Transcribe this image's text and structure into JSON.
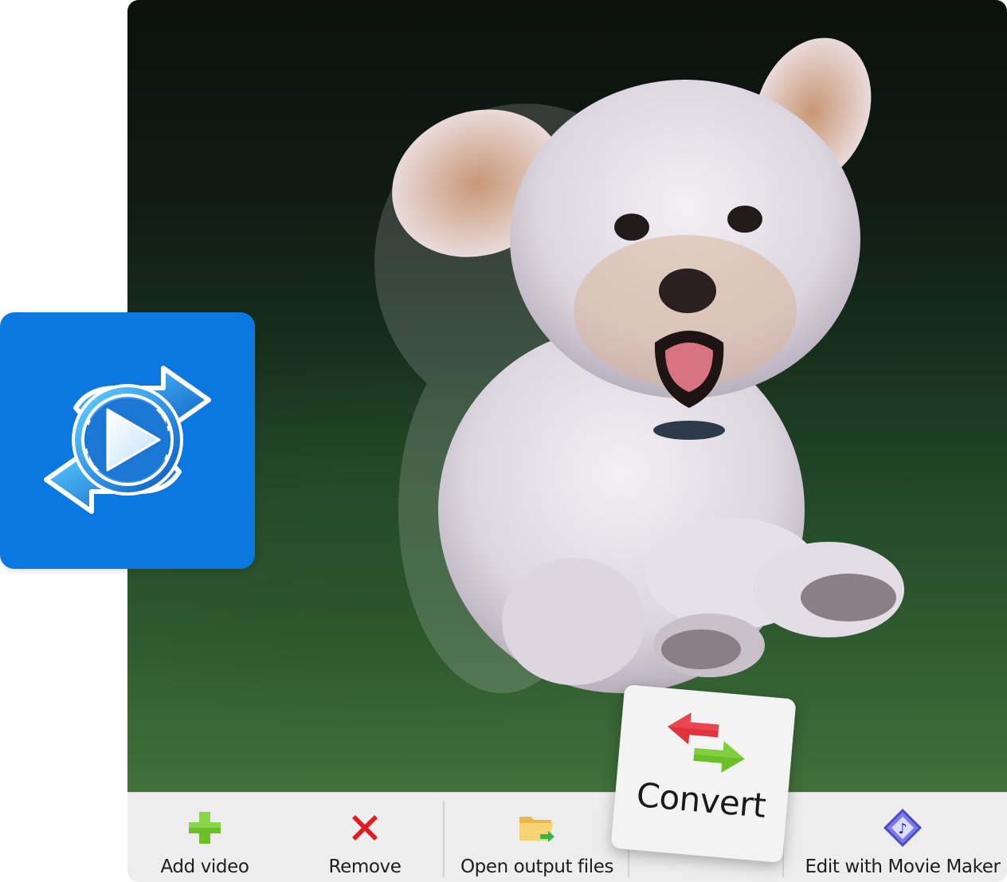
{
  "app": {
    "logo_icon": "convert-play-icon",
    "accent_color": "#0a78df"
  },
  "preview": {
    "subject": "dog-photo"
  },
  "toolbar": {
    "add_video": {
      "label": "Add video",
      "icon": "plus-icon",
      "color": "#6cc027"
    },
    "remove": {
      "label": "Remove",
      "icon": "x-icon",
      "color": "#e11b22"
    },
    "open_output": {
      "label": "Open output files",
      "icon": "folder-icon"
    },
    "convert": {
      "label": "Convert",
      "icon": "convert-arrows-icon"
    },
    "movie_maker": {
      "label": "Edit with Movie Maker",
      "icon": "movie-maker-icon"
    }
  }
}
